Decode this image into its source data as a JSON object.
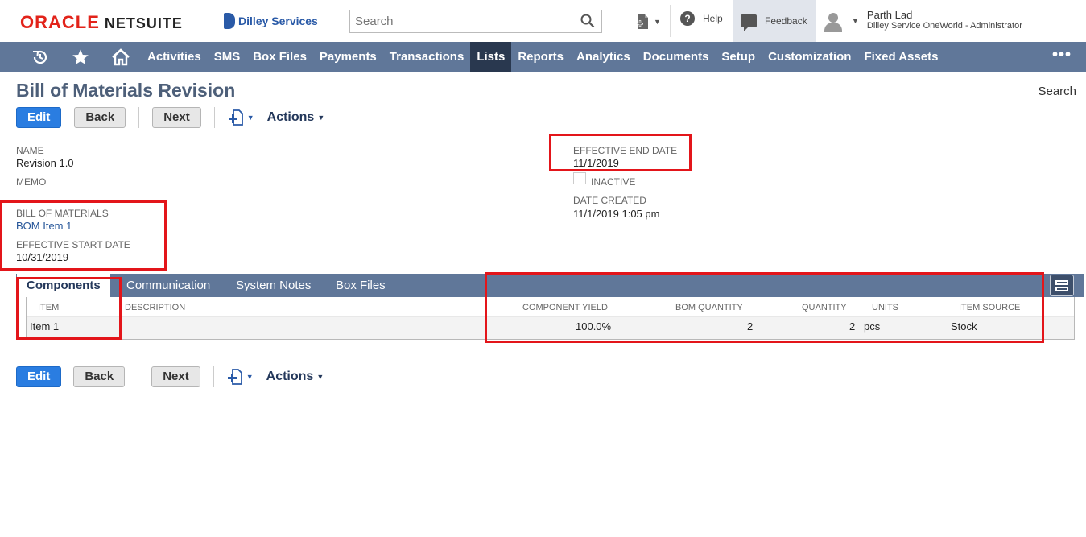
{
  "brand": {
    "oracle": "ORACLE",
    "netsuite": "NETSUITE",
    "company": "Dilley Services"
  },
  "header": {
    "search_placeholder": "Search",
    "help_label": "Help",
    "feedback_label": "Feedback",
    "user_name": "Parth Lad",
    "user_role": "Dilley Service OneWorld - Administrator"
  },
  "nav": {
    "items": [
      "Activities",
      "SMS",
      "Box Files",
      "Payments",
      "Transactions",
      "Lists",
      "Reports",
      "Analytics",
      "Documents",
      "Setup",
      "Customization",
      "Fixed Assets"
    ],
    "active": "Lists",
    "more": "•••"
  },
  "page": {
    "title": "Bill of Materials Revision",
    "search_link": "Search"
  },
  "buttons": {
    "edit": "Edit",
    "back": "Back",
    "next": "Next",
    "actions": "Actions"
  },
  "fields": {
    "name_label": "NAME",
    "name_value": "Revision 1.0",
    "memo_label": "MEMO",
    "bom_label": "BILL OF MATERIALS",
    "bom_value": "BOM Item 1",
    "start_label": "EFFECTIVE START DATE",
    "start_value": "10/31/2019",
    "end_label": "EFFECTIVE END DATE",
    "end_value": "11/1/2019",
    "inactive_label": "INACTIVE",
    "inactive_checked": false,
    "created_label": "DATE CREATED",
    "created_value": "11/1/2019 1:05 pm"
  },
  "subtabs": [
    "Components",
    "Communication",
    "System Notes",
    "Box Files"
  ],
  "components": {
    "columns": [
      "ITEM",
      "DESCRIPTION",
      "COMPONENT YIELD",
      "BOM QUANTITY",
      "QUANTITY",
      "UNITS",
      "ITEM SOURCE"
    ],
    "rows": [
      {
        "item": "Item 1",
        "description": "",
        "component_yield": "100.0%",
        "bom_quantity": "2",
        "quantity": "2",
        "units": "pcs",
        "item_source": "Stock"
      }
    ]
  },
  "colors": {
    "nav_bg": "#607799",
    "nav_active": "#29384f",
    "primary_button": "#2a7de1",
    "highlight": "#e3151a",
    "title": "#4d5f79"
  }
}
